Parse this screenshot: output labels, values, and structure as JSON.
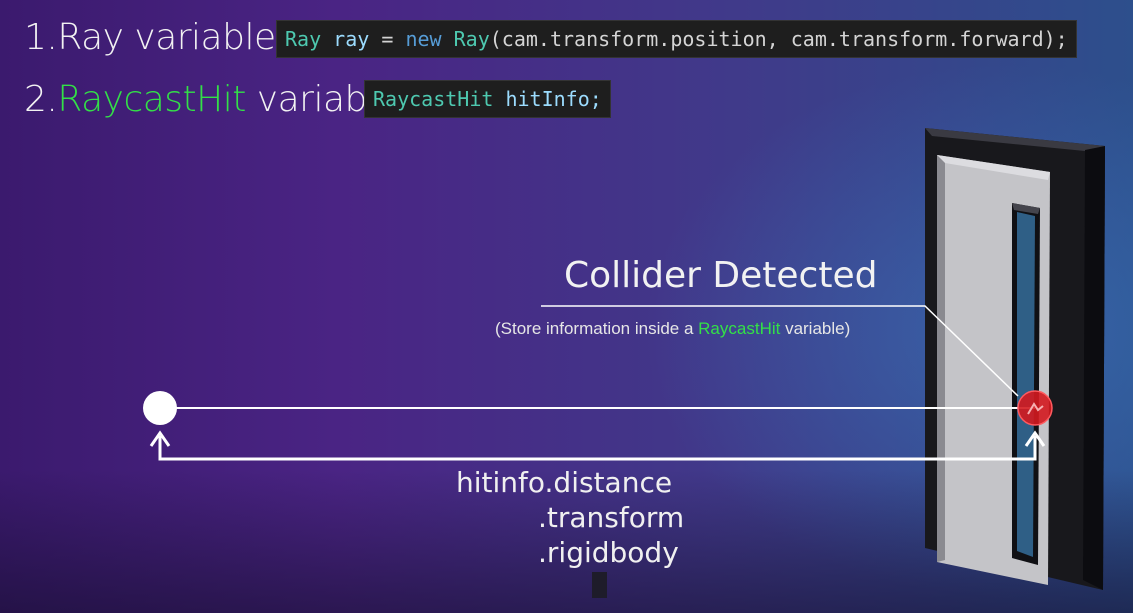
{
  "steps": [
    {
      "number": "1.",
      "text_before": "Ray variable",
      "highlight": "",
      "text_after": ""
    },
    {
      "number": "2.",
      "text_before": "",
      "highlight": "RaycastHit",
      "text_after": " variable."
    }
  ],
  "code": {
    "line1": {
      "t1": "Ray",
      "t2": "ray",
      "t3": "=",
      "t4": "new",
      "t5": "Ray",
      "t6": "(cam.transform.position, cam.transform.forward);"
    },
    "line2": {
      "t1": "RaycastHit",
      "t2": "hitInfo;"
    }
  },
  "diagram": {
    "title": "Collider Detected",
    "subtitle_before": "(Store information inside a ",
    "subtitle_highlight": "RaycastHit",
    "subtitle_after": " variable)",
    "properties": [
      "hitinfo.distance",
      ".transform",
      ".rigidbody"
    ]
  },
  "colors": {
    "highlight": "#33e047",
    "origin_dot": "#ffffff",
    "hit_dot": "#d41a1f",
    "line": "#ffffff"
  },
  "icons": [
    "door-image",
    "origin-point-icon",
    "hit-point-icon",
    "arrow-up-icon"
  ]
}
